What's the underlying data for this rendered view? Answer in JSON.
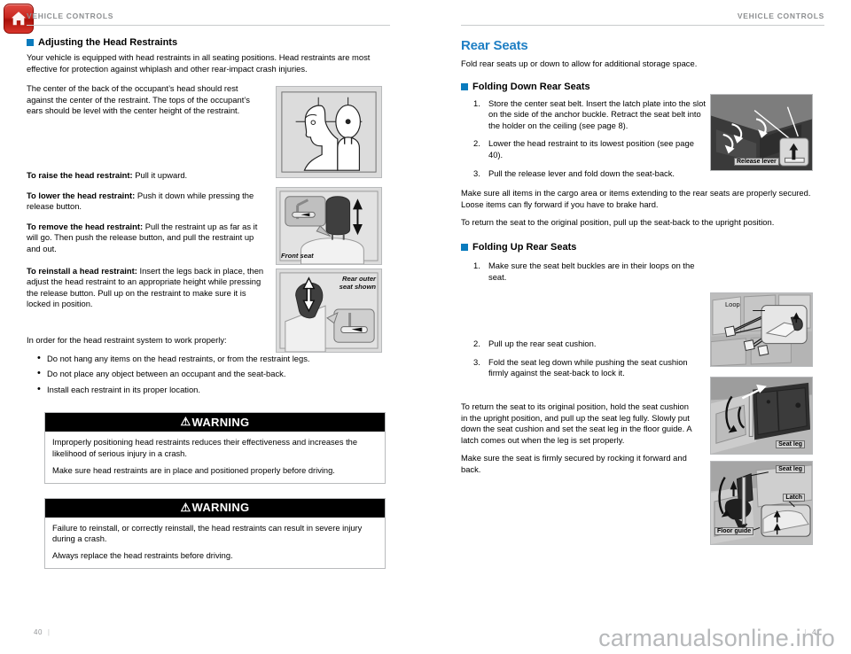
{
  "header": {
    "left_label": "VEHICLE CONTROLS",
    "right_label": "VEHICLE CONTROLS",
    "home_icon": "home-icon"
  },
  "left_column": {
    "subtitle": "Adjusting the Head Restraints",
    "paragraphs": {
      "intro": "Your vehicle is equipped with head restraints in all seating positions. Head restraints are most effective for protection against whiplash and other rear-impact crash injuries.",
      "center": "The center of the back of the occupant’s head should rest against the center of the restraint. The tops of the occupant’s ears should be level with the center height of the restraint.",
      "raise_label": "To raise the head restraint:",
      "raise_text": " Pull it upward.",
      "lower_label": "To lower the head restraint:",
      "lower_text": " Push it down while pressing the release button.",
      "remove_label": "To remove the head restraint:",
      "remove_text": " Pull the restraint up as far as it will go. Then push the release button, and pull the restraint up and out.",
      "reinstall_label": "To reinstall a head restraint:",
      "reinstall_text": " Insert the legs back in place, then adjust the head restraint to an appropriate height while pressing the release button. Pull up on the restraint to make sure it is locked in position.",
      "proper_intro": "In order for the head restraint system to work properly:"
    },
    "bullets": [
      "Do not hang any items on the head restraints, or from the restraint legs.",
      "Do not place any object between an occupant and the seat-back.",
      "Install each restraint in its proper location."
    ],
    "warnings": [
      {
        "title": "WARNING",
        "lines": [
          "Improperly positioning head restraints reduces their effectiveness and increases the likelihood of serious injury in a crash.",
          "Make sure head restraints are in place and positioned properly before driving."
        ]
      },
      {
        "title": "WARNING",
        "lines": [
          "Failure to reinstall, or correctly reinstall, the head restraints can result in severe injury during a crash.",
          "Always replace the head restraints before driving."
        ]
      }
    ],
    "figures": [
      {
        "name": "head-restraint-position-figure",
        "caption": ""
      },
      {
        "name": "front-seat-head-restraint-figure",
        "caption": "Front seat"
      },
      {
        "name": "rear-outer-seat-head-restraint-figure",
        "caption": "Rear outer\nseat shown"
      }
    ]
  },
  "right_column": {
    "section_title": "Rear Seats",
    "section_intro": "Fold rear seats up or down to allow for additional storage space.",
    "folding_down": {
      "subtitle": "Folding Down Rear Seats",
      "steps": [
        {
          "num": "1.",
          "text": "Store the center seat belt. Insert the latch plate into the slot on the side of the anchor buckle. Retract the seat belt into the holder on the ceiling (see page 8)."
        },
        {
          "num": "2.",
          "text": "Lower the head restraint to its lowest position (see page 40)."
        },
        {
          "num": "3.",
          "text": "Pull the release lever and fold down the seat-back."
        }
      ],
      "notes": [
        "Make sure all items in the cargo area or items extending to the rear seats are properly secured. Loose items can fly forward if you have to brake hard.",
        "To return the seat to the original position, pull up the seat-back to the upright position."
      ]
    },
    "folding_up": {
      "subtitle": "Folding Up Rear Seats",
      "steps": [
        {
          "num": "1.",
          "text": "Make sure the seat belt buckles are in their loops on the seat."
        },
        {
          "num": "2.",
          "text": "Pull up the rear seat cushion."
        },
        {
          "num": "3.",
          "text": "Fold the seat leg down while pushing the seat cushion firmly against the seat-back to lock it."
        }
      ],
      "notes": [
        "To return the seat to its original position, hold the seat cushion in the upright position, and pull up the seat leg fully. Slowly put down the seat cushion and set the seat leg in the floor guide. A latch comes out when the leg is set properly.",
        "Make sure the seat is firmly secured by rocking it forward and back."
      ]
    },
    "figures": [
      {
        "name": "release-lever-figure",
        "captions": [
          "Release lever"
        ]
      },
      {
        "name": "seat-belt-loop-figure",
        "captions": [
          "Loop"
        ]
      },
      {
        "name": "seat-leg-figure",
        "captions": [
          "Seat leg"
        ]
      },
      {
        "name": "floor-guide-latch-figure",
        "captions": [
          "Seat leg",
          "Latch",
          "Floor guide"
        ]
      }
    ]
  },
  "footer": {
    "page_left": "40",
    "page_right": "41",
    "watermark": "carmanualsonline.info"
  },
  "colors": {
    "accent_blue": "#1f7fc4",
    "square_blue": "#0a7bbd",
    "header_gray": "#8d8f91",
    "warning_black": "#000000",
    "home_red": "#c8261f"
  }
}
